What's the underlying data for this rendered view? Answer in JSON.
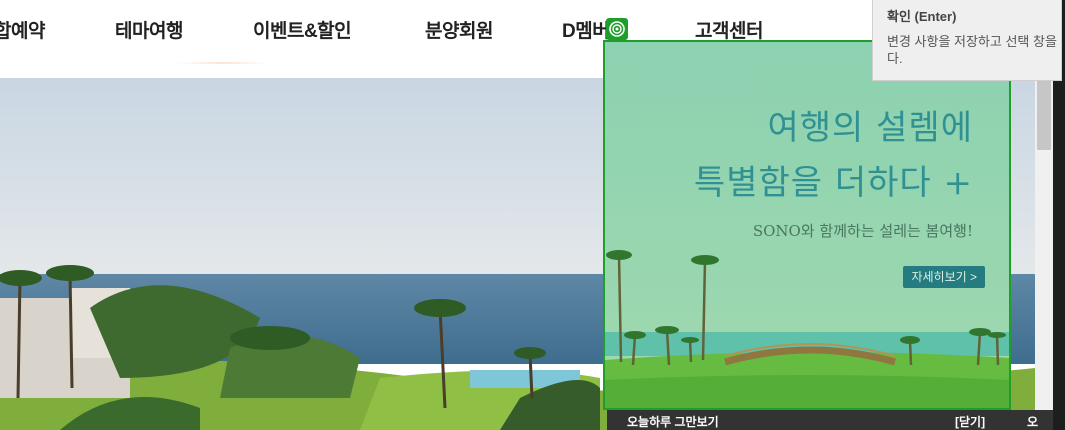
{
  "nav": {
    "items": [
      "합예약",
      "테마여행",
      "이벤트&할인",
      "분양회원",
      "D멤버스",
      "고객센터"
    ]
  },
  "tooltip": {
    "title": "확인 (Enter)",
    "desc": "변경 사항을 저장하고 선택 창을 닫습니다."
  },
  "popup": {
    "headline_1": "여행의 설렘에",
    "headline_2": "특별함을 더하다 +",
    "subtext": "SONO와 함께하는 설레는 봄여행!",
    "detail_button": "자세히보기 >",
    "bar": {
      "dont_show_today": "오늘하루 그만보기",
      "close": "[닫기]",
      "extra": "오"
    }
  },
  "colors": {
    "highlight": "#1f9e2c",
    "popup_headline": "#2e8aa3",
    "popup_button": "#1f6f8c"
  },
  "icons": [
    "target-icon"
  ]
}
